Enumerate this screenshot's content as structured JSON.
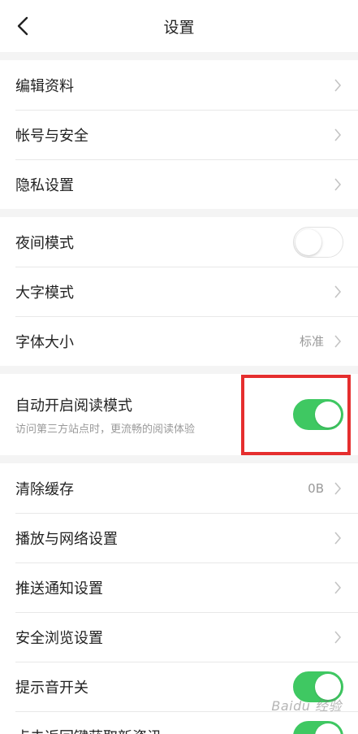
{
  "header": {
    "title": "设置"
  },
  "groups": [
    {
      "rows": [
        {
          "label": "编辑资料"
        },
        {
          "label": "帐号与安全"
        },
        {
          "label": "隐私设置"
        }
      ]
    },
    {
      "rows": [
        {
          "label": "夜间模式",
          "toggle": "off"
        },
        {
          "label": "大字模式"
        },
        {
          "label": "字体大小",
          "value": "标准"
        }
      ]
    },
    {
      "rows": [
        {
          "label": "自动开启阅读模式",
          "sub": "访问第三方站点时，更流畅的阅读体验",
          "toggle": "on"
        }
      ]
    },
    {
      "rows": [
        {
          "label": "清除缓存",
          "value": "0B"
        },
        {
          "label": "播放与网络设置"
        },
        {
          "label": "推送通知设置"
        },
        {
          "label": "安全浏览设置"
        },
        {
          "label": "提示音开关",
          "toggle": "on"
        },
        {
          "label": "点击返回键获取新资讯",
          "toggle": "on"
        }
      ]
    }
  ],
  "colors": {
    "toggle_on": "#3fc862",
    "highlight": "#e52e2e"
  },
  "watermark": "Baidu 经验"
}
